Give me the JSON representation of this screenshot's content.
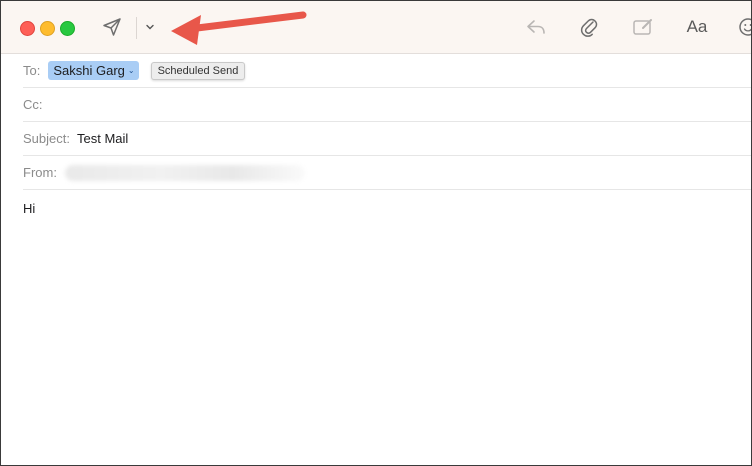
{
  "toolbar": {
    "icons": [
      "send-icon",
      "chevron-down-icon",
      "reply-icon",
      "paperclip-icon",
      "photo-markup-icon",
      "font-icon",
      "emoji-icon"
    ],
    "font_label": "Aa",
    "chevron": "⌄"
  },
  "colors": {
    "toolbar_bg": "#fbf6f2",
    "close": "#fe5f57",
    "minimize": "#febc2e",
    "maximize": "#28c840",
    "recipient_token": "#a9cdf5",
    "annotation_arrow": "#e8574a"
  },
  "fields": {
    "to_label": "To:",
    "to_recipient": "Sakshi Garg",
    "to_caret": "⌄",
    "tooltip": "Scheduled Send",
    "cc_label": "Cc:",
    "subject_label": "Subject:",
    "subject_value": "Test Mail",
    "from_label": "From:"
  },
  "message": {
    "body": "Hi"
  }
}
